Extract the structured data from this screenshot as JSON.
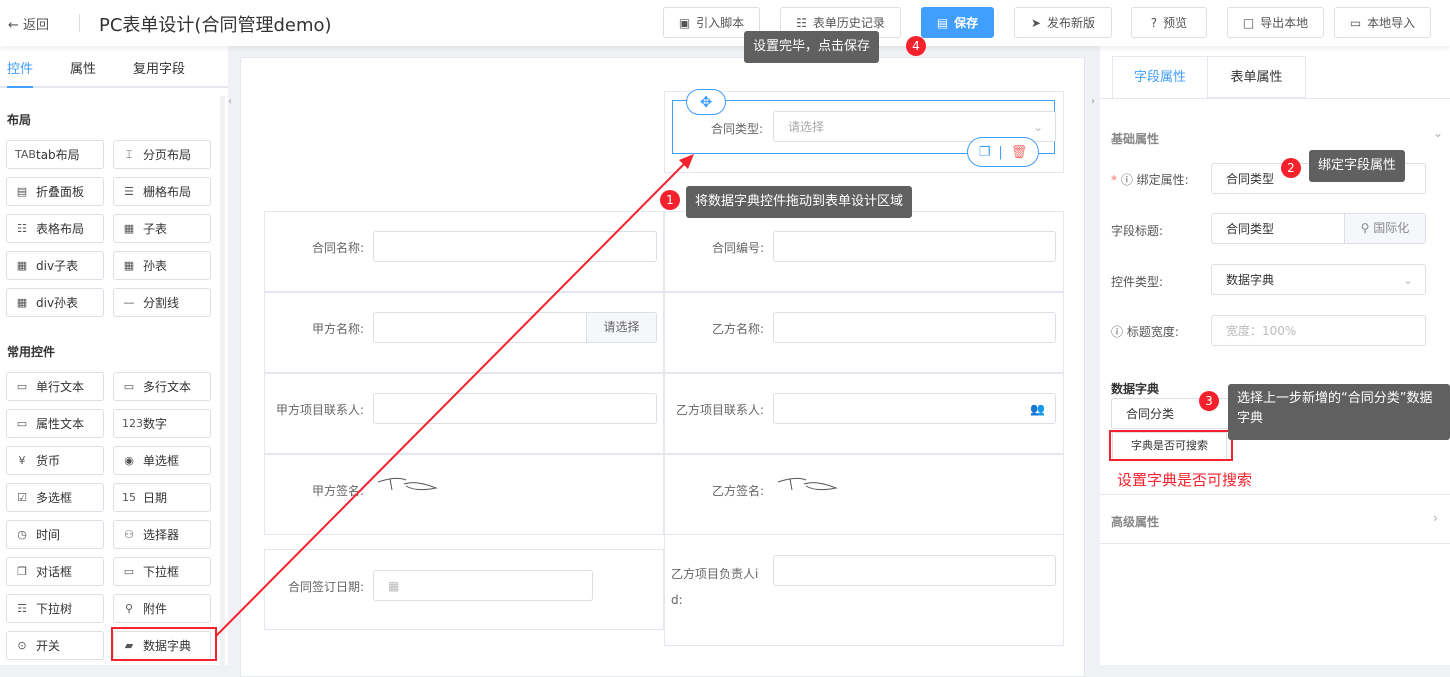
{
  "header": {
    "back": "返回",
    "title": "PC表单设计(合同管理demo)",
    "buttons": {
      "script": "引入脚本",
      "history": "表单历史记录",
      "save": "保存",
      "publish": "发布新版",
      "preview": "预览",
      "export": "导出本地",
      "import": "本地导入"
    }
  },
  "left": {
    "tabs": [
      "控件",
      "属性",
      "复用字段"
    ],
    "layout_title": "布局",
    "layout": [
      "tab布局",
      "分页布局",
      "折叠面板",
      "栅格布局",
      "表格布局",
      "子表",
      "div子表",
      "孙表",
      "div孙表",
      "分割线"
    ],
    "common_title": "常用控件",
    "common": [
      "单行文本",
      "多行文本",
      "属性文本",
      "数字",
      "货币",
      "单选框",
      "多选框",
      "日期",
      "时间",
      "选择器",
      "对话框",
      "下拉框",
      "下拉树",
      "附件",
      "开关",
      "数据字典"
    ]
  },
  "form": {
    "selected": {
      "label": "合同类型:",
      "placeholder": "请选择"
    },
    "fields": {
      "name": "合同名称:",
      "no": "合同编号:",
      "party_a": "甲方名称:",
      "party_a_btn": "请选择",
      "party_b": "乙方名称:",
      "a_contact": "甲方项目联系人:",
      "b_contact": "乙方项目联系人:",
      "a_sign": "甲方签名:",
      "b_sign": "乙方签名:",
      "sign_date": "合同签订日期:",
      "b_owner": "乙方项目负责人i d:"
    }
  },
  "right": {
    "tabs": [
      "字段属性",
      "表单属性"
    ],
    "basic": "基础属性",
    "bind_label": "绑定属性:",
    "bind_value": "合同类型",
    "title_label": "字段标题:",
    "title_value": "合同类型",
    "i18n": "国际化",
    "ctrl_label": "控件类型:",
    "ctrl_value": "数据字典",
    "width_label": "标题宽度:",
    "width_placeholder": "宽度：100%",
    "dict_label": "数据字典",
    "dict_value": "合同分类",
    "searchable": "字典是否可搜索",
    "advanced": "高级属性"
  },
  "annotations": {
    "step1": "将数据字典控件拖动到表单设计区域",
    "step2": "绑定字段属性",
    "step3": "选择上一步新增的“合同分类”数据字典",
    "step4": "设置完毕，点击保存",
    "note": "设置字典是否可搜索",
    "n1": "1",
    "n2": "2",
    "n3": "3",
    "n4": "4"
  },
  "colors": {
    "accent": "#409eff",
    "annotation": "#f5222d"
  }
}
